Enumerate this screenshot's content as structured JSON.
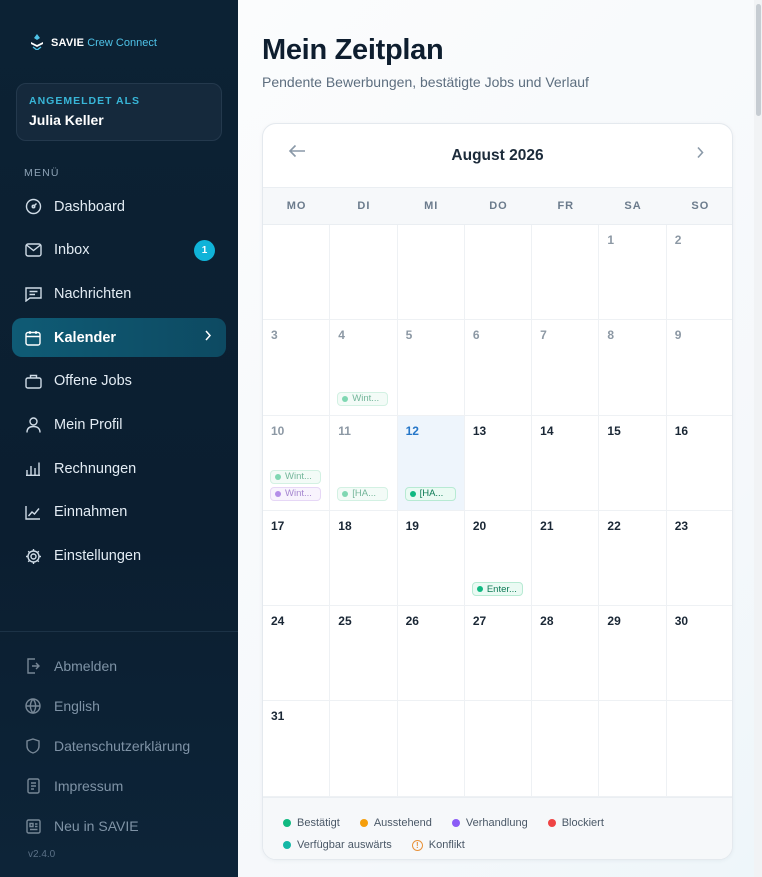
{
  "app": {
    "brand_bold": "SAVIE",
    "brand_rest": "Crew Connect",
    "version": "v2.4.0"
  },
  "user": {
    "label": "ANGEMELDET ALS",
    "name": "Julia Keller"
  },
  "menu": {
    "label": "MENÜ",
    "items": [
      {
        "label": "Dashboard",
        "icon": "dashboard-icon"
      },
      {
        "label": "Inbox",
        "icon": "inbox-icon",
        "badge": "1"
      },
      {
        "label": "Nachrichten",
        "icon": "messages-icon"
      },
      {
        "label": "Kalender",
        "icon": "calendar-icon",
        "active": true
      },
      {
        "label": "Offene Jobs",
        "icon": "briefcase-icon"
      },
      {
        "label": "Mein Profil",
        "icon": "user-icon"
      },
      {
        "label": "Rechnungen",
        "icon": "bar-chart-icon"
      },
      {
        "label": "Einnahmen",
        "icon": "trend-icon"
      },
      {
        "label": "Einstellungen",
        "icon": "gear-icon"
      }
    ]
  },
  "footer": {
    "items": [
      {
        "label": "Abmelden",
        "icon": "logout-icon"
      },
      {
        "label": "English",
        "icon": "globe-icon"
      },
      {
        "label": "Datenschutzerklärung",
        "icon": "shield-icon"
      },
      {
        "label": "Impressum",
        "icon": "document-icon"
      },
      {
        "label": "Neu in SAVIE",
        "icon": "news-icon"
      }
    ]
  },
  "page": {
    "title": "Mein Zeitplan",
    "subtitle": "Pendente Bewerbungen, bestätigte Jobs und Verlauf"
  },
  "calendar": {
    "month": "August 2026",
    "weekdays": [
      "MO",
      "DI",
      "MI",
      "DO",
      "FR",
      "SA",
      "SO"
    ],
    "today": 12,
    "days": [
      {
        "d": "",
        "past": false
      },
      {
        "d": "",
        "past": false
      },
      {
        "d": "",
        "past": false
      },
      {
        "d": "",
        "past": false
      },
      {
        "d": "",
        "past": false
      },
      {
        "d": "1",
        "past": true
      },
      {
        "d": "2",
        "past": true
      },
      {
        "d": "3",
        "past": true
      },
      {
        "d": "4",
        "past": true,
        "events": [
          {
            "label": "Wint...",
            "kind": "confirmed-past"
          }
        ]
      },
      {
        "d": "5",
        "past": true
      },
      {
        "d": "6",
        "past": true
      },
      {
        "d": "7",
        "past": true
      },
      {
        "d": "8",
        "past": true
      },
      {
        "d": "9",
        "past": true
      },
      {
        "d": "10",
        "past": true,
        "events": [
          {
            "label": "Wint...",
            "kind": "confirmed-past"
          },
          {
            "label": "Wint...",
            "kind": "negotiation-past"
          }
        ]
      },
      {
        "d": "11",
        "past": true,
        "events": [
          {
            "label": "[HA...",
            "kind": "confirmed-past"
          }
        ]
      },
      {
        "d": "12",
        "today": true,
        "events": [
          {
            "label": "[HA...",
            "kind": "confirmed"
          }
        ]
      },
      {
        "d": "13"
      },
      {
        "d": "14"
      },
      {
        "d": "15"
      },
      {
        "d": "16"
      },
      {
        "d": "17"
      },
      {
        "d": "18"
      },
      {
        "d": "19"
      },
      {
        "d": "20",
        "events": [
          {
            "label": "Enter...",
            "kind": "confirmed"
          }
        ]
      },
      {
        "d": "21"
      },
      {
        "d": "22"
      },
      {
        "d": "23"
      },
      {
        "d": "24"
      },
      {
        "d": "25"
      },
      {
        "d": "26"
      },
      {
        "d": "27"
      },
      {
        "d": "28"
      },
      {
        "d": "29"
      },
      {
        "d": "30"
      },
      {
        "d": "31"
      },
      {
        "d": ""
      },
      {
        "d": ""
      },
      {
        "d": ""
      },
      {
        "d": ""
      },
      {
        "d": ""
      },
      {
        "d": ""
      }
    ],
    "event_styles": {
      "confirmed": {
        "bg": "#eafaf3",
        "border": "#b7ead3",
        "dot": "#10b981",
        "text": "#0d7a55"
      },
      "confirmed-past": {
        "bg": "#f3fbf7",
        "border": "#d3f1e3",
        "dot": "#7fd7b2",
        "text": "#74b69a"
      },
      "negotiation-past": {
        "bg": "#f8f3fd",
        "border": "#e6d7f6",
        "dot": "#b48ee8",
        "text": "#a586cf"
      }
    }
  },
  "legend": [
    {
      "label": "Bestätigt",
      "color": "#10b981"
    },
    {
      "label": "Ausstehend",
      "color": "#f59e0b"
    },
    {
      "label": "Verhandlung",
      "color": "#8b5cf6"
    },
    {
      "label": "Blockiert",
      "color": "#ef4444"
    },
    {
      "label": "Verfügbar auswärts",
      "color": "#14b8a6"
    },
    {
      "label": "Konflikt",
      "color": "#e8923a",
      "warn": true
    }
  ],
  "colors": {
    "accent": "#10b3d8",
    "sidebar": "#0b1e30",
    "active_nav": "#0f5b75",
    "today_bg": "#eef5fc"
  }
}
